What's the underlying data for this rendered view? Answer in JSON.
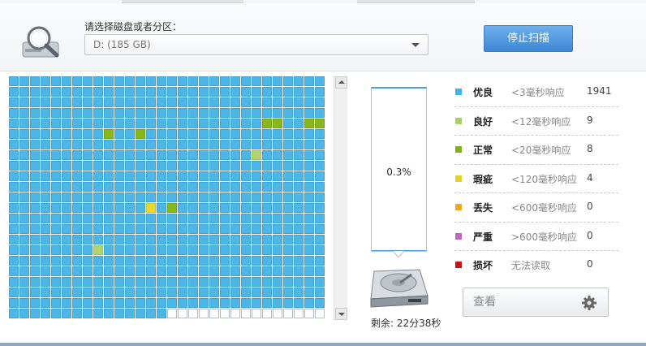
{
  "header": {
    "select_label": "请选择磁盘或者分区：",
    "selected_disk": "D:  (185 GB)",
    "stop_button": "停止扫描",
    "disk_icon": "magnifier-disk-icon"
  },
  "scan": {
    "grid_columns": 30,
    "grid_rows": 23,
    "cells_scanned": 675,
    "special_cells": [
      {
        "row": 4,
        "col": 24,
        "status": "normal"
      },
      {
        "row": 4,
        "col": 25,
        "status": "normal"
      },
      {
        "row": 4,
        "col": 28,
        "status": "normal"
      },
      {
        "row": 4,
        "col": 29,
        "status": "normal"
      },
      {
        "row": 5,
        "col": 9,
        "status": "normal"
      },
      {
        "row": 5,
        "col": 12,
        "status": "normal"
      },
      {
        "row": 7,
        "col": 23,
        "status": "good"
      },
      {
        "row": 12,
        "col": 13,
        "status": "defect"
      },
      {
        "row": 12,
        "col": 15,
        "status": "normal"
      },
      {
        "row": 16,
        "col": 8,
        "status": "good"
      }
    ]
  },
  "progress": {
    "percent_text": "0.3%",
    "fraction": 0.003,
    "remaining": "剩余: 22分38秒",
    "hdd_icon": "hard-drive-icon"
  },
  "legend": [
    {
      "name": "优良",
      "desc": "<3毫秒响应",
      "count": "1941",
      "color": "#3fb4ea"
    },
    {
      "name": "良好",
      "desc": "<12毫秒响应",
      "count": "9",
      "color": "#a9cf6a"
    },
    {
      "name": "正常",
      "desc": "<20毫秒响应",
      "count": "8",
      "color": "#7fb218"
    },
    {
      "name": "瑕疵",
      "desc": "<120毫秒响应",
      "count": "4",
      "color": "#e4d423"
    },
    {
      "name": "丢失",
      "desc": "<600毫秒响应",
      "count": "0",
      "color": "#f2a81d"
    },
    {
      "name": "严重",
      "desc": ">600毫秒响应",
      "count": "0",
      "color": "#c267b9"
    },
    {
      "name": "损坏",
      "desc": "无法读取",
      "count": "0",
      "color": "#cc1111"
    }
  ],
  "report": {
    "button_label": "查看",
    "gear_icon": "gear-icon"
  }
}
